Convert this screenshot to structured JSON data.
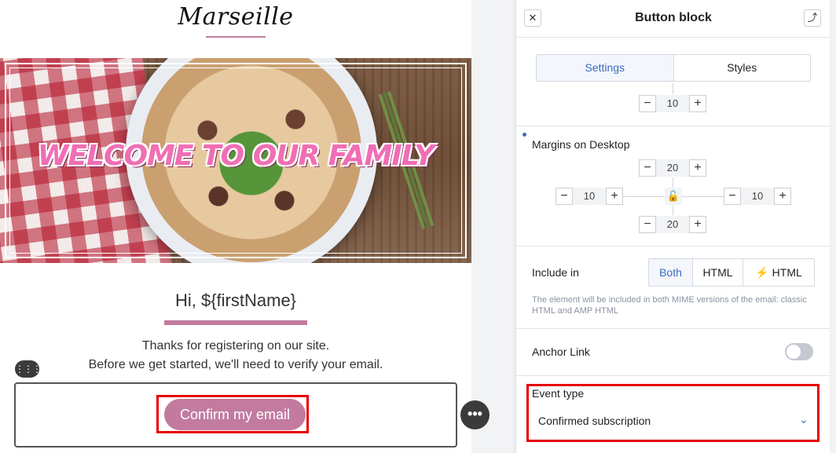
{
  "email": {
    "logo_text": "Marseille",
    "hero_text": "WELCOME TO OUR FAMILY",
    "greeting": "Hi, ${firstName}",
    "body_line_1": "Thanks for registering on our site.",
    "body_line_2": "Before we get started, we'll need to verify your email.",
    "button_label": "Confirm my email",
    "drag_icon": "⋮⋮⋮",
    "more_icon": "•••"
  },
  "panel": {
    "title": "Button block",
    "close_icon": "✕",
    "collapse_icon": "⤴",
    "tabs": [
      {
        "label": "Settings"
      },
      {
        "label": "Styles"
      }
    ],
    "top_stepper_value": "10",
    "margins": {
      "label": "Margins on Desktop",
      "top": "20",
      "left": "10",
      "right": "10",
      "bottom": "20",
      "lock_icon": "🔓"
    },
    "include_in": {
      "label": "Include in",
      "options": [
        "Both",
        "HTML",
        "HTML"
      ],
      "amp_icon": "⚡",
      "helper": "The element will be included in both MIME versions of the email: classic HTML and AMP HTML"
    },
    "anchor_link": {
      "label": "Anchor Link"
    },
    "event_type": {
      "label": "Event type",
      "value": "Confirmed subscription",
      "chevron": "⌄"
    },
    "stepper_minus": "−",
    "stepper_plus": "+"
  },
  "colors": {
    "accent": "#c27b9f",
    "link_blue": "#3a6cc1",
    "highlight_red": "#e60000"
  }
}
